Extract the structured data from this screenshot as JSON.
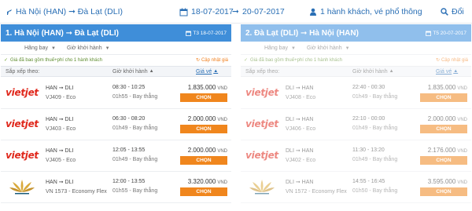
{
  "search_bar": {
    "route": "Hà Nội (HAN) ➞ Đà Lạt (DLI)",
    "depart_date": "18-07-2017",
    "return_date": "20-07-2017",
    "passengers": "1 hành khách, vé phổ thông",
    "change": "Đổi"
  },
  "colors": {
    "header_active": "#3f8ed9",
    "header_inactive": "#90bfec",
    "button": "#f0861d",
    "link": "#2a6fb5"
  },
  "panels": [
    {
      "title": "1. Hà Nội (HAN) ➞ Đà Lạt (DLI)",
      "date": "T3 18-07-2017",
      "filter_airline": "Hãng bay",
      "filter_time": "Giờ khởi hành",
      "notice": "Giá đã bao gồm thuế+phí cho 1 hành khách",
      "update": "Cập nhật giá",
      "sort_label": "Sắp xếp theo:",
      "sort_time": "Giờ khởi hành",
      "sort_price": "Giá vé",
      "flights": [
        {
          "airline_logo": "vietjet",
          "logo_text": "vietjet",
          "route": "HAN ➞ DLI",
          "code": "VJ409 - Eco",
          "time": "08:30 - 10:25",
          "duration": "01h55 - Bay thẳng",
          "price": "1.835.000",
          "currency": "VND",
          "button": "CHỌN"
        },
        {
          "airline_logo": "vietjet",
          "logo_text": "vietjet",
          "route": "HAN ➞ DLI",
          "code": "VJ403 - Eco",
          "time": "06:30 - 08:20",
          "duration": "01h49 - Bay thẳng",
          "price": "2.000.000",
          "currency": "VND",
          "button": "CHỌN"
        },
        {
          "airline_logo": "vietjet",
          "logo_text": "vietjet",
          "route": "HAN ➞ DLI",
          "code": "VJ405 - Eco",
          "time": "12:05 - 13:55",
          "duration": "01h49 - Bay thẳng",
          "price": "2.000.000",
          "currency": "VND",
          "button": "CHỌN"
        },
        {
          "airline_logo": "vietnam-airlines",
          "logo_text": "",
          "route": "HAN ➞ DLI",
          "code": "VN 1573 - Economy Flex",
          "time": "12:00 - 13:55",
          "duration": "01h55 - Bay thẳng",
          "price": "3.320.000",
          "currency": "VND",
          "button": "CHỌN"
        }
      ]
    },
    {
      "title": "2. Đà Lạt (DLI) ➞ Hà Nội (HAN)",
      "date": "T5 20-07-2017",
      "filter_airline": "Hãng bay",
      "filter_time": "Giờ khởi hành",
      "notice": "Giá đã bao gồm thuế+phí cho 1 hành khách",
      "update": "Cập nhật giá",
      "sort_label": "Sắp xếp theo:",
      "sort_time": "Giờ khởi hành",
      "sort_price": "Giá vé",
      "flights": [
        {
          "airline_logo": "vietjet",
          "logo_text": "vietjet",
          "route": "DLI ➞ HAN",
          "code": "VJ408 - Eco",
          "time": "22:40 - 00:30",
          "duration": "01h49 - Bay thẳng",
          "price": "1.835.000",
          "currency": "VND",
          "button": "CHỌN"
        },
        {
          "airline_logo": "vietjet",
          "logo_text": "vietjet",
          "route": "DLI ➞ HAN",
          "code": "VJ406 - Eco",
          "time": "22:10 - 00:00",
          "duration": "01h49 - Bay thẳng",
          "price": "2.000.000",
          "currency": "VND",
          "button": "CHỌN"
        },
        {
          "airline_logo": "vietjet",
          "logo_text": "vietjet",
          "route": "DLI ➞ HAN",
          "code": "VJ402 - Eco",
          "time": "11:30 - 13:20",
          "duration": "01h49 - Bay thẳng",
          "price": "2.176.000",
          "currency": "VND",
          "button": "CHỌN"
        },
        {
          "airline_logo": "vietnam-airlines",
          "logo_text": "",
          "route": "DLI ➞ HAN",
          "code": "VN 1572 - Economy Flex",
          "time": "14:55 - 16:45",
          "duration": "01h50 - Bay thẳng",
          "price": "3.595.000",
          "currency": "VND",
          "button": "CHỌN"
        }
      ]
    }
  ]
}
